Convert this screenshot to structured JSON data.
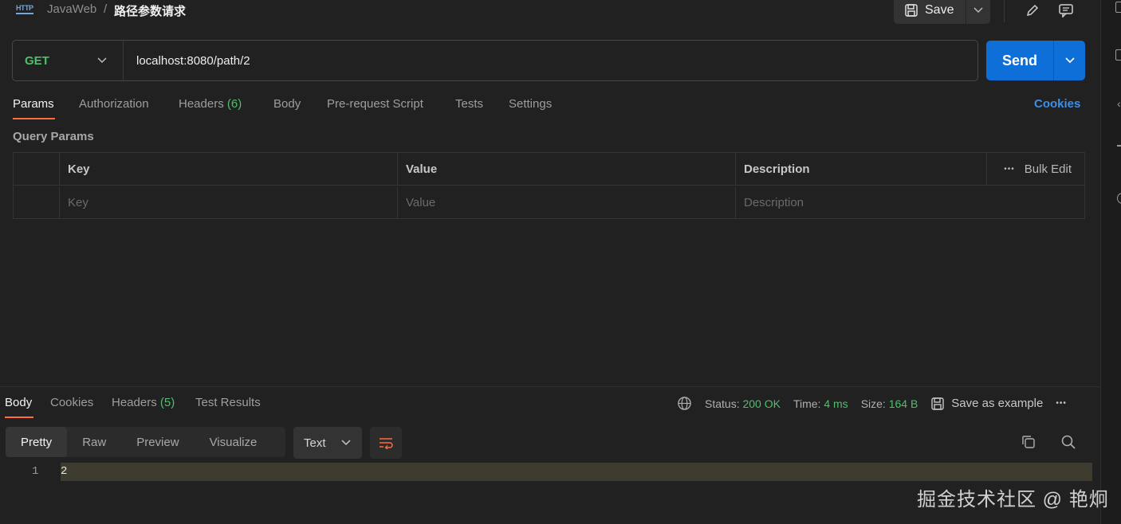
{
  "breadcrumb": {
    "icon_text": "HTTP",
    "parent": "JavaWeb",
    "separator": "/",
    "current": "路径参数请求"
  },
  "toolbar": {
    "save_label": "Save"
  },
  "request": {
    "method": "GET",
    "url": "localhost:8080/path/2",
    "send_label": "Send"
  },
  "request_tabs": [
    {
      "label": "Params",
      "active": true
    },
    {
      "label": "Authorization"
    },
    {
      "label": "Headers",
      "count": "(6)"
    },
    {
      "label": "Body"
    },
    {
      "label": "Pre-request Script"
    },
    {
      "label": "Tests"
    },
    {
      "label": "Settings"
    }
  ],
  "cookies_label": "Cookies",
  "query_params": {
    "title": "Query Params",
    "columns": [
      "Key",
      "Value",
      "Description"
    ],
    "placeholders": [
      "Key",
      "Value",
      "Description"
    ],
    "bulk_edit": "Bulk Edit",
    "more": "•••"
  },
  "response": {
    "tabs": [
      {
        "label": "Body",
        "active": true
      },
      {
        "label": "Cookies"
      },
      {
        "label": "Headers",
        "count": "(5)"
      },
      {
        "label": "Test Results"
      }
    ],
    "status_label": "Status:",
    "status_value": "200 OK",
    "time_label": "Time:",
    "time_value": "4 ms",
    "size_label": "Size:",
    "size_value": "164 B",
    "save_example": "Save as example",
    "more": "•••",
    "formats": [
      "Pretty",
      "Raw",
      "Preview",
      "Visualize"
    ],
    "type_select": "Text",
    "lines": [
      {
        "number": "1",
        "content": "2"
      }
    ]
  },
  "watermark": "掘金技术社区 @ 艳炯",
  "colors": {
    "accent": "#ff6c37",
    "send": "#0f6fd8",
    "success": "#4fbf6a",
    "link": "#3d8fe8"
  }
}
